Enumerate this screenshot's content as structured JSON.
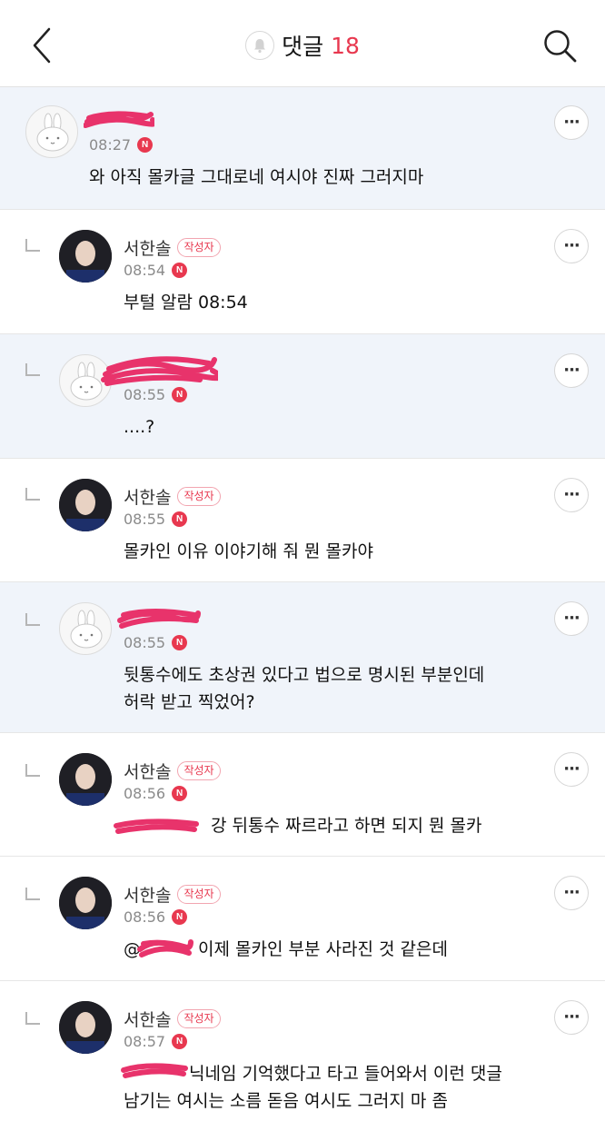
{
  "header": {
    "title": "댓글",
    "count": "18",
    "back_icon": "chevron-left-icon",
    "search_icon": "search-icon",
    "bell_icon": "bell-icon"
  },
  "comments": [
    {
      "name": "",
      "badge": "",
      "time": "08:27",
      "new": "N",
      "text": "와 아직 몰카글 그대로네 여시야 진짜 그러지마",
      "text2": ""
    },
    {
      "name": "서한솔",
      "badge": "작성자",
      "time": "08:54",
      "new": "N",
      "text": "부털 알람 08:54",
      "text2": ""
    },
    {
      "name": "",
      "badge": "",
      "time": "08:55",
      "new": "N",
      "text": "....?",
      "text2": ""
    },
    {
      "name": "서한솔",
      "badge": "작성자",
      "time": "08:55",
      "new": "N",
      "text": "몰카인 이유 이야기해 줘 뭔 몰카야",
      "text2": ""
    },
    {
      "name": "",
      "badge": "",
      "time": "08:55",
      "new": "N",
      "text": "뒷통수에도 초상권 있다고 법으로 명시된 부분인데",
      "text2": "허락 받고 찍었어?"
    },
    {
      "name": "서한솔",
      "badge": "작성자",
      "time": "08:56",
      "new": "N",
      "text": "강 뒤통수 짜르라고 하면 되지 뭔 몰카",
      "text2": ""
    },
    {
      "name": "서한솔",
      "badge": "작성자",
      "time": "08:56",
      "new": "N",
      "text": "이제 몰카인 부분 사라진 것 같은데",
      "mention_prefix": "@",
      "text2": ""
    },
    {
      "name": "서한솔",
      "badge": "작성자",
      "time": "08:57",
      "new": "N",
      "text": "닉네임 기억했다고 타고 들어와서 이런 댓글",
      "text2": "남기는 여시는 소름 돋음 여시도 그러지 마 좀"
    }
  ],
  "colors": {
    "accent": "#e8384f",
    "highlight_bg": "#f0f4fa",
    "scribble": "#e8336b"
  }
}
